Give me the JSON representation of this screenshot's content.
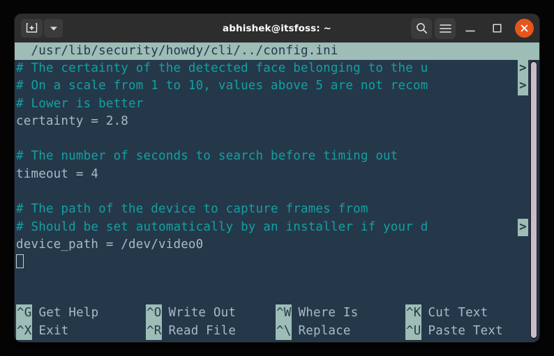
{
  "window": {
    "title": "abhishek@itsfoss: ~",
    "titlebar": {
      "new_tab_icon": "new-tab-icon",
      "new_tab_glyph": "+",
      "dropdown_icon": "chevron-down-icon",
      "dropdown_glyph": "▼",
      "search_icon": "search-icon",
      "menu_icon": "hamburger-menu-icon",
      "minimize_icon": "minimize-icon",
      "maximize_icon": "maximize-icon",
      "close_icon": "close-icon",
      "close_glyph": "✕"
    },
    "colors": {
      "titlebar_bg": "#2d2d2d",
      "terminal_bg": "#25384a",
      "accent_close": "#e8551b",
      "nano_bar_bg": "#9dbdb6",
      "comment_fg": "#13a0a0",
      "text_fg": "#a9bac6",
      "scrollbar_thumb": "#c8bfc6"
    }
  },
  "editor": {
    "header": "  /usr/lib/security/howdy/cli/../config.ini",
    "continuation_marker": ">",
    "lines": [
      {
        "text": "# The certainty of the detected face belonging to the u",
        "kind": "comment",
        "truncated": true
      },
      {
        "text": "# On a scale from 1 to 10, values above 5 are not recom",
        "kind": "comment",
        "truncated": true
      },
      {
        "text": "# Lower is better",
        "kind": "comment",
        "truncated": false
      },
      {
        "text": "certainty = 2.8",
        "kind": "code",
        "truncated": false
      },
      {
        "text": "",
        "kind": "blank",
        "truncated": false
      },
      {
        "text": "# The number of seconds to search before timing out",
        "kind": "comment",
        "truncated": false
      },
      {
        "text": "timeout = 4",
        "kind": "code",
        "truncated": false
      },
      {
        "text": "",
        "kind": "blank",
        "truncated": false
      },
      {
        "text": "# The path of the device to capture frames from",
        "kind": "comment",
        "truncated": false
      },
      {
        "text": "# Should be set automatically by an installer if your d",
        "kind": "comment",
        "truncated": true
      },
      {
        "text": "device_path = /dev/video0",
        "kind": "code",
        "truncated": false
      }
    ],
    "cursor": {
      "line_index": 11,
      "column": 0
    }
  },
  "shortcuts": {
    "rows": [
      [
        {
          "key": "^G",
          "label": "Get Help"
        },
        {
          "key": "^O",
          "label": "Write Out"
        },
        {
          "key": "^W",
          "label": "Where Is"
        },
        {
          "key": "^K",
          "label": "Cut Text"
        }
      ],
      [
        {
          "key": "^X",
          "label": "Exit"
        },
        {
          "key": "^R",
          "label": "Read File"
        },
        {
          "key": "^\\",
          "label": "Replace"
        },
        {
          "key": "^U",
          "label": "Paste Text"
        }
      ]
    ]
  }
}
